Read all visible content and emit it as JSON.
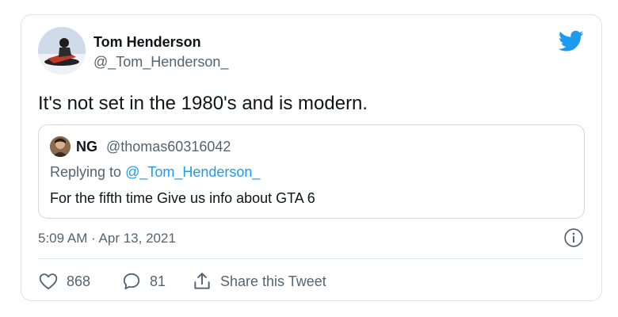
{
  "author": {
    "name": "Tom Henderson",
    "handle": "@_Tom_Henderson_"
  },
  "tweet": {
    "text": "It's not set in the 1980's and is modern.",
    "timestamp": "5:09 AM · Apr 13, 2021"
  },
  "quoted_tweet": {
    "name": "NG",
    "handle": "@thomas60316042",
    "replying_prefix": "Replying to ",
    "replying_to": "@_Tom_Henderson_",
    "text": "For the fifth time Give us info about GTA 6"
  },
  "actions": {
    "likes": "868",
    "replies": "81",
    "share_label": "Share this Tweet"
  },
  "icons": {
    "brand": "twitter-bird-icon",
    "info": "info-icon",
    "like": "heart-icon",
    "reply": "reply-bubble-icon",
    "share": "share-icon"
  },
  "colors": {
    "brand": "#1d9bf0",
    "text": "#0f1419",
    "muted": "#536471",
    "border": "#dfe3e6"
  }
}
